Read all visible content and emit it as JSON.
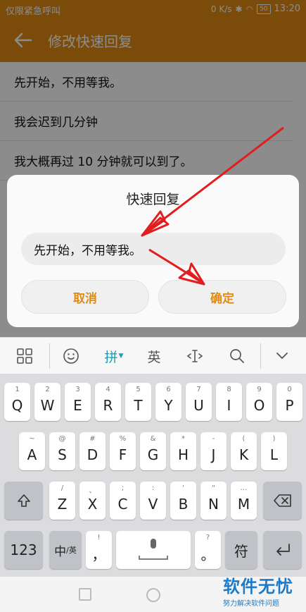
{
  "status_bar": {
    "left_text": "仅限紧急呼叫",
    "speed": "0 K/s",
    "battery": "50",
    "time": "13:20"
  },
  "app_bar": {
    "title": "修改快速回复",
    "back_icon": "arrow-left-icon"
  },
  "replies": [
    "先开始，不用等我。",
    "我会迟到几分钟",
    "我大概再过 10 分钟就可以到了。"
  ],
  "dialog": {
    "title": "快速回复",
    "input_value": "先开始，不用等我。",
    "cancel_label": "取消",
    "ok_label": "确定"
  },
  "keyboard": {
    "toolbar": {
      "grid_icon": "grid-icon",
      "emoji_icon": "emoji-icon",
      "pinyin_label": "拼",
      "english_label": "英",
      "cursor_icon": "text-cursor-icon",
      "search_icon": "search-icon",
      "collapse_icon": "chevron-down-icon"
    },
    "row1": [
      {
        "hint": "1",
        "key": "Q"
      },
      {
        "hint": "2",
        "key": "W"
      },
      {
        "hint": "3",
        "key": "E"
      },
      {
        "hint": "4",
        "key": "R"
      },
      {
        "hint": "5",
        "key": "T"
      },
      {
        "hint": "6",
        "key": "Y"
      },
      {
        "hint": "7",
        "key": "U"
      },
      {
        "hint": "8",
        "key": "I"
      },
      {
        "hint": "9",
        "key": "O"
      },
      {
        "hint": "0",
        "key": "P"
      }
    ],
    "row2": [
      {
        "hint": "~",
        "key": "A"
      },
      {
        "hint": "@",
        "key": "S"
      },
      {
        "hint": "#",
        "key": "D"
      },
      {
        "hint": "%",
        "key": "F"
      },
      {
        "hint": "&",
        "key": "G"
      },
      {
        "hint": "*",
        "key": "H"
      },
      {
        "hint": "-",
        "key": "J"
      },
      {
        "hint": "(",
        "key": "K"
      },
      {
        "hint": ")",
        "key": "L"
      }
    ],
    "row3": [
      {
        "hint": "/",
        "key": "Z"
      },
      {
        "hint": "、",
        "key": "X"
      },
      {
        "hint": ";",
        "key": "C"
      },
      {
        "hint": ":",
        "key": "V"
      },
      {
        "hint": "'",
        "key": "B"
      },
      {
        "hint": "\"",
        "key": "N"
      },
      {
        "hint": "…",
        "key": "M"
      }
    ],
    "row4": {
      "num_label": "123",
      "lang_label": "中",
      "lang_sub": "/英",
      "comma_hint": "!",
      "comma_key": "，",
      "period_hint": "?",
      "period_key": "。",
      "symbol_label": "符"
    }
  },
  "watermark": {
    "title": "软件无忧",
    "subtitle": "努力解决软件问题"
  },
  "colors": {
    "accent": "#e08b12",
    "annotation_red": "#e21d1d",
    "pinyin_active": "#19a0b5"
  }
}
